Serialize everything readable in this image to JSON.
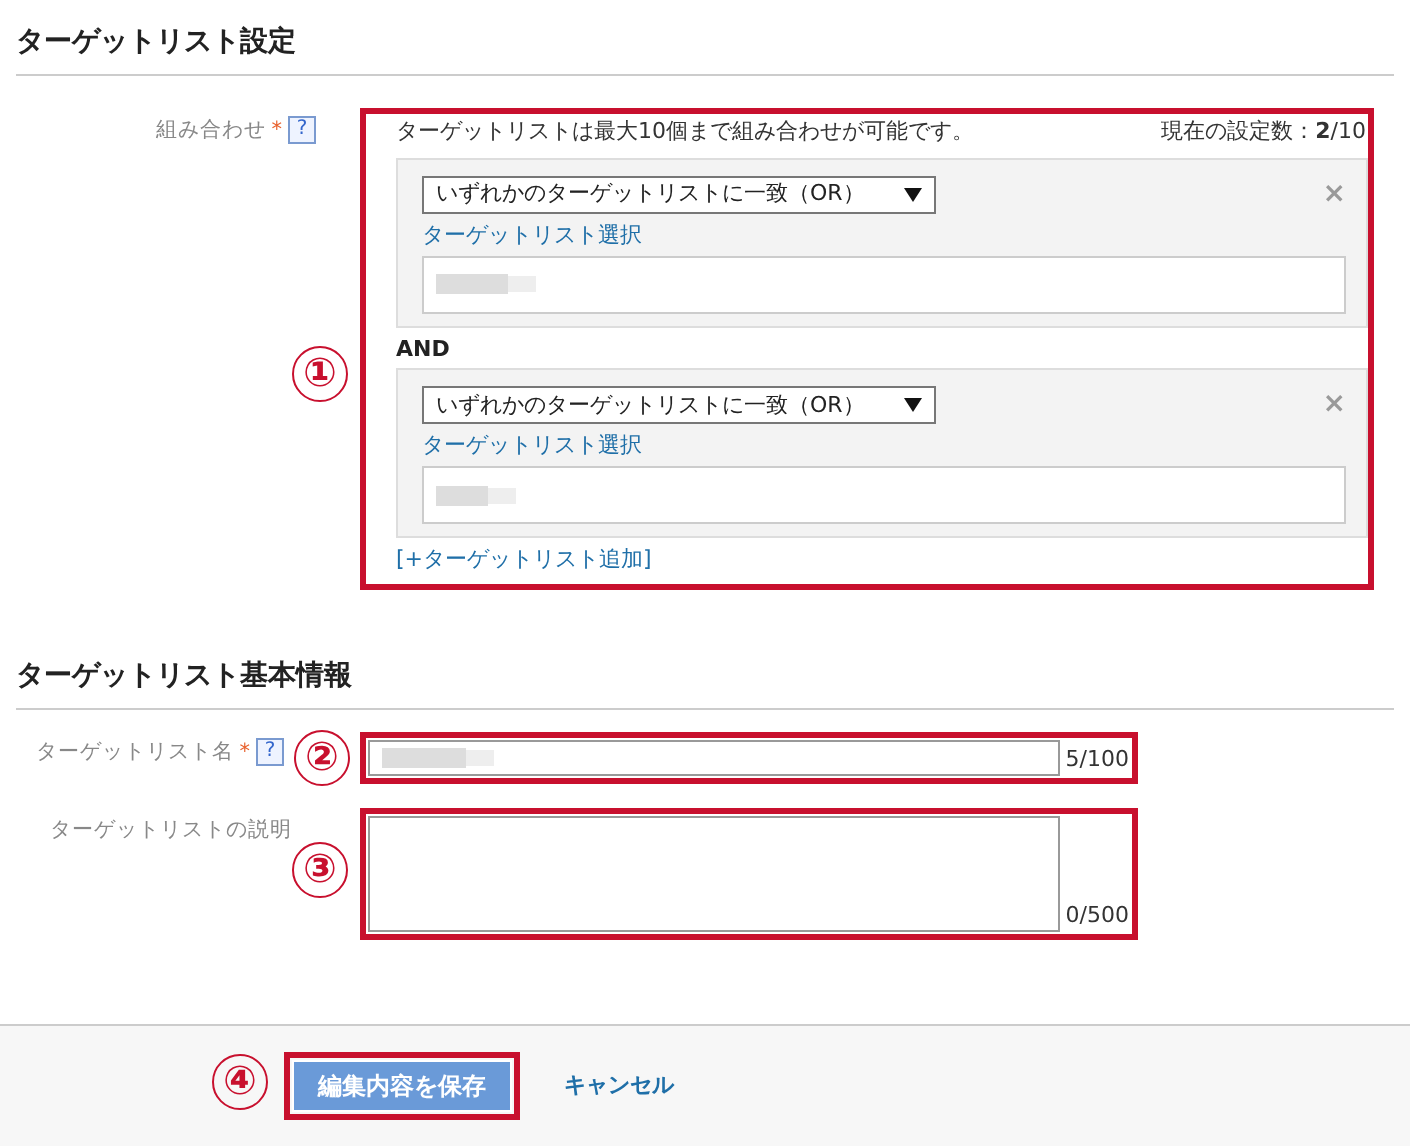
{
  "target_list_settings": {
    "title": "ターゲットリスト設定",
    "combination": {
      "label": "組み合わせ",
      "required_mark": "*",
      "help": "?",
      "callout": "①",
      "note": "ターゲットリストは最大10個まで組み合わせが可能です。",
      "count": "現在の設定数：**2**/10",
      "groups": [
        {
          "match_select": "いずれかのターゲットリストに一致（OR）",
          "select_link": "ターゲットリスト選択",
          "remove": "×"
        },
        {
          "match_select": "いずれかのターゲットリストに一致（OR）",
          "select_link": "ターゲットリスト選択",
          "remove": "×"
        }
      ],
      "connector": "AND",
      "add_link": "[+ターゲットリスト追加]"
    }
  },
  "basic_info": {
    "title": "ターゲットリスト基本情報",
    "fields": [
      {
        "kind": "text",
        "label": "ターゲットリスト名",
        "required_mark": "*",
        "help": "?",
        "callout": "②",
        "counter": "5/100"
      },
      {
        "kind": "textarea",
        "label": "ターゲットリストの説明",
        "callout": "③",
        "counter": "0/500"
      }
    ]
  },
  "footer": {
    "callout": "④",
    "save": "編集内容を保存",
    "cancel": "キャンセル"
  }
}
